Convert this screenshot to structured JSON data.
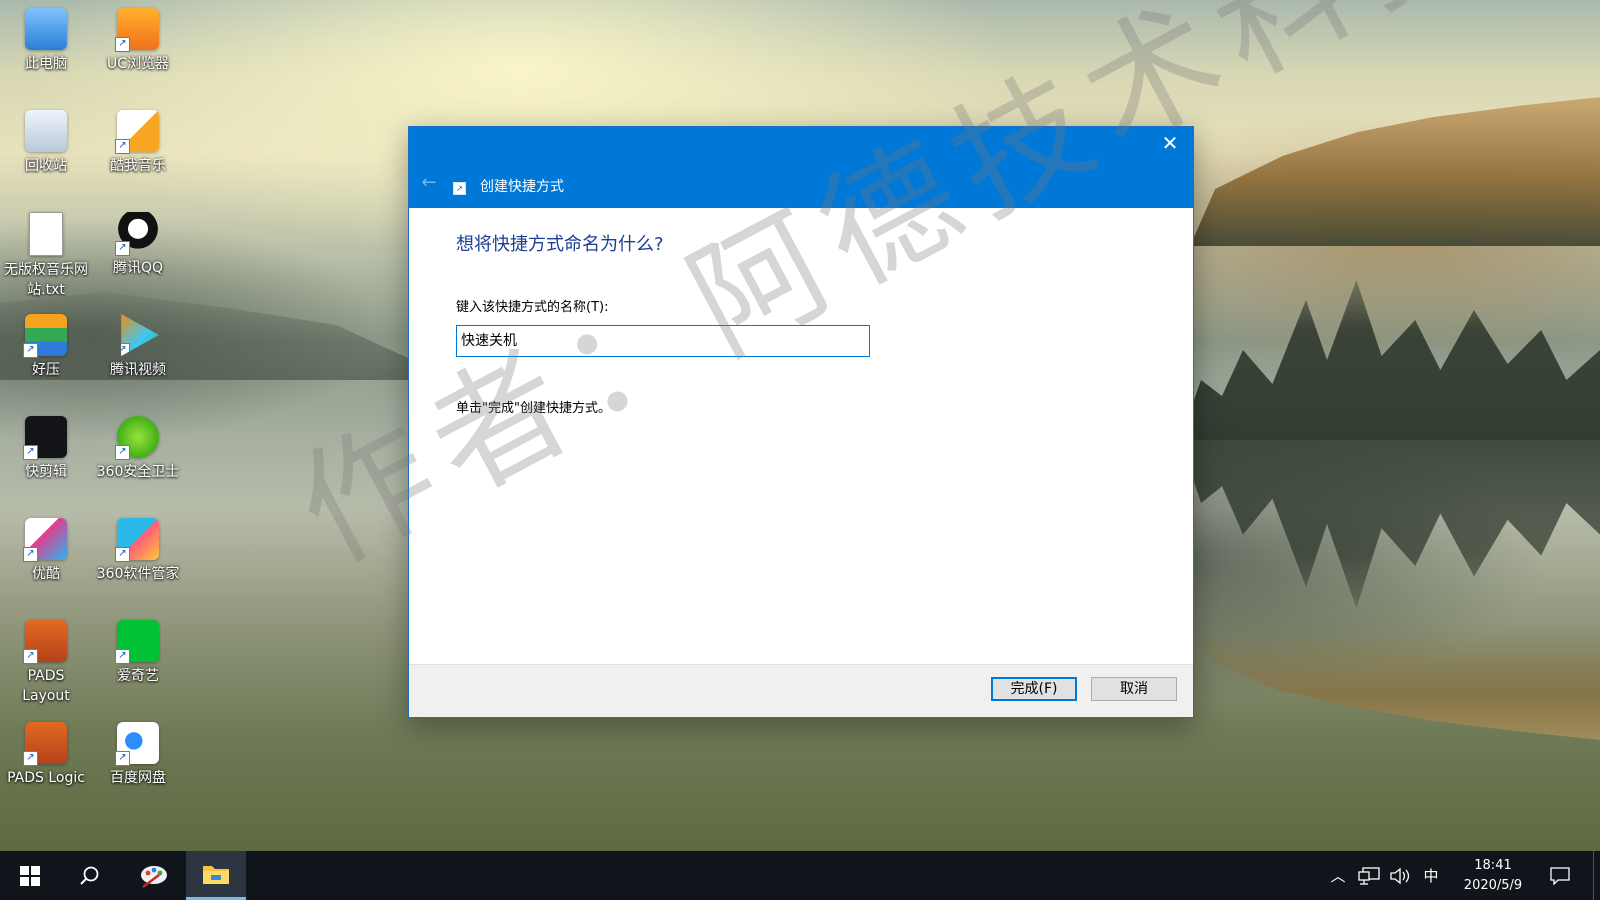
{
  "desktop": {
    "icons_col1": [
      {
        "label": "此电脑",
        "icon": "computer-icon",
        "shortcut": false
      },
      {
        "label": "回收站",
        "icon": "recycle-bin-icon",
        "shortcut": false
      },
      {
        "label": "无版权音乐网站.txt",
        "icon": "text-file-icon",
        "shortcut": false
      },
      {
        "label": "好压",
        "icon": "haozip-icon",
        "shortcut": true
      },
      {
        "label": "快剪辑",
        "icon": "kuaijianji-icon",
        "shortcut": true
      },
      {
        "label": "优酷",
        "icon": "youku-icon",
        "shortcut": true
      },
      {
        "label": "PADS Layout",
        "icon": "pads-layout-icon",
        "shortcut": true
      },
      {
        "label": "PADS Logic",
        "icon": "pads-logic-icon",
        "shortcut": true
      }
    ],
    "icons_col2": [
      {
        "label": "UC浏览器",
        "icon": "uc-browser-icon",
        "shortcut": true
      },
      {
        "label": "酷我音乐",
        "icon": "kuwo-music-icon",
        "shortcut": true
      },
      {
        "label": "腾讯QQ",
        "icon": "qq-icon",
        "shortcut": true
      },
      {
        "label": "腾讯视频",
        "icon": "tencent-video-icon",
        "shortcut": true
      },
      {
        "label": "360安全卫士",
        "icon": "360-security-icon",
        "shortcut": true
      },
      {
        "label": "360软件管家",
        "icon": "360-software-manager-icon",
        "shortcut": true
      },
      {
        "label": "爱奇艺",
        "icon": "iqiyi-icon",
        "shortcut": true
      },
      {
        "label": "百度网盘",
        "icon": "baidu-netdisk-icon",
        "shortcut": true
      }
    ],
    "watermark": "作者：阿德技术科技"
  },
  "dialog": {
    "title": "创建快捷方式",
    "question": "想将快捷方式命名为什么?",
    "name_label": "键入该快捷方式的名称(T):",
    "name_value": "快速关机",
    "hint": "单击\"完成\"创建快捷方式。",
    "finish_label": "完成(F)",
    "cancel_label": "取消",
    "accent_color": "#0078d7"
  },
  "taskbar": {
    "tray": {
      "ime": "中",
      "time": "18:41",
      "date": "2020/5/9"
    }
  }
}
